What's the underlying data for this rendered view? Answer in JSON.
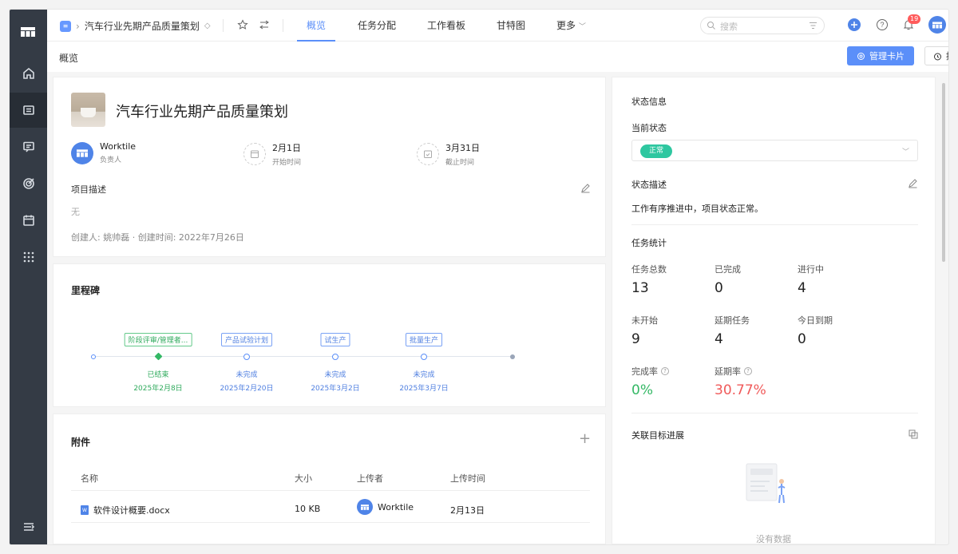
{
  "breadcrumb": {
    "project_name": "汽车行业先期产品质量策划"
  },
  "tabs": [
    {
      "label": "概览",
      "active": true
    },
    {
      "label": "任务分配",
      "active": false
    },
    {
      "label": "工作看板",
      "active": false
    },
    {
      "label": "甘特图",
      "active": false
    },
    {
      "label": "更多",
      "active": false
    }
  ],
  "search": {
    "placeholder": "搜索"
  },
  "notifications": {
    "count": "19"
  },
  "subbar": {
    "title": "概览",
    "manage_cards_label": "管理卡片",
    "remind_label": "提醒"
  },
  "project": {
    "title": "汽车行业先期产品质量策划",
    "owner_name": "Worktile",
    "owner_label": "负责人",
    "start_date": "2月1日",
    "start_label": "开始时间",
    "end_date": "3月31日",
    "end_label": "截止时间",
    "desc_label": "项目描述",
    "desc_value": "无",
    "creator_line": "创建人: 姚帅磊 · 创建时间: 2022年7月26日"
  },
  "milestones": {
    "heading": "里程碑",
    "items": [
      {
        "name": "阶段评审/管理者...",
        "status": "已结束",
        "date": "2025年2月8日",
        "done": true
      },
      {
        "name": "产品试验计划",
        "status": "未完成",
        "date": "2025年2月20日",
        "done": false
      },
      {
        "name": "试生产",
        "status": "未完成",
        "date": "2025年3月2日",
        "done": false
      },
      {
        "name": "批量生产",
        "status": "未完成",
        "date": "2025年3月7日",
        "done": false
      }
    ]
  },
  "attachments": {
    "heading": "附件",
    "columns": [
      "名称",
      "大小",
      "上传者",
      "上传时间"
    ],
    "rows": [
      {
        "name": "软件设计概要.docx",
        "size": "10 KB",
        "uploader": "Worktile",
        "time": "2月13日"
      }
    ]
  },
  "status_panel": {
    "heading": "状态信息",
    "current_label": "当前状态",
    "current_value": "正常",
    "desc_label": "状态描述",
    "desc_value": "工作有序推进中，项目状态正常。",
    "stats_heading": "任务统计",
    "stats": [
      {
        "label": "任务总数",
        "value": "13"
      },
      {
        "label": "已完成",
        "value": "0"
      },
      {
        "label": "进行中",
        "value": "4"
      },
      {
        "label": "未开始",
        "value": "9"
      },
      {
        "label": "延期任务",
        "value": "4"
      },
      {
        "label": "今日到期",
        "value": "0"
      }
    ],
    "completion_label": "完成率",
    "completion_value": "0%",
    "delay_label": "延期率",
    "delay_value": "30.77%",
    "goals_heading": "关联目标进展",
    "empty_text": "没有数据"
  },
  "colors": {
    "accent": "#5b8ff9",
    "success": "#34b865",
    "danger": "#f05a5a",
    "status_pill": "#2ec7a0",
    "rail": "#343b45"
  }
}
